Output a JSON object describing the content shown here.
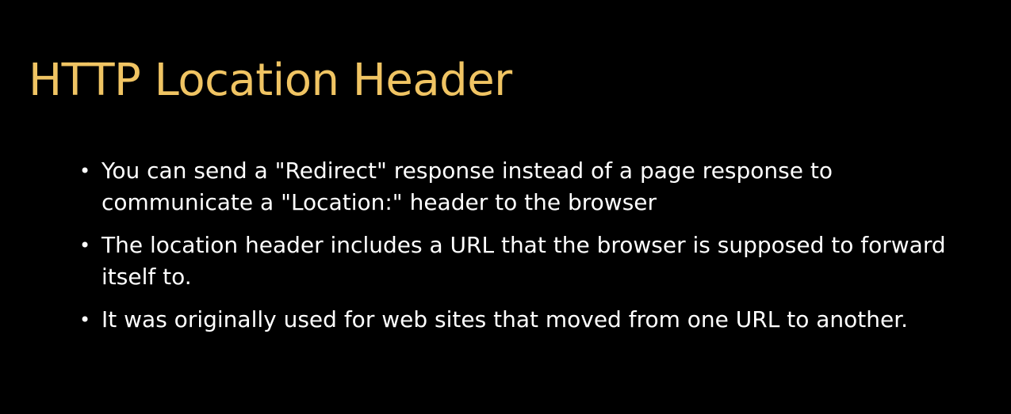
{
  "slide": {
    "title": "HTTP Location Header",
    "bullet_symbol": "•",
    "bullets": [
      {
        "text": "You can send a \"Redirect\" response instead of a page response to communicate a \"Location:\" header to the browser"
      },
      {
        "text": "The location header includes a URL that the browser is supposed to forward itself to."
      },
      {
        "text": "It was originally used for web sites that moved from one URL to another."
      }
    ]
  },
  "colors": {
    "background": "#000000",
    "title": "#f0c463",
    "body_text": "#ffffff"
  }
}
